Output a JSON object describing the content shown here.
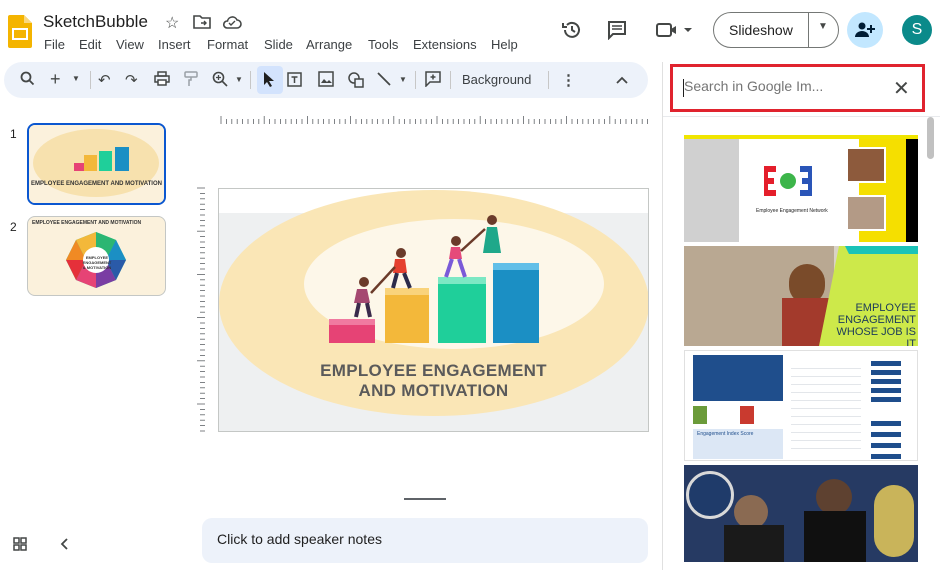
{
  "app": {
    "title": "SketchBubble",
    "menu": [
      "File",
      "Edit",
      "View",
      "Insert",
      "Format",
      "Slide",
      "Arrange",
      "Tools",
      "Extensions",
      "Help"
    ],
    "slideshow_label": "Slideshow",
    "avatar_initial": "S"
  },
  "toolbar": {
    "background_label": "Background",
    "icons": [
      "search-icon",
      "add-icon",
      "undo-icon",
      "redo-icon",
      "print-icon",
      "paint-format-icon",
      "zoom-icon",
      "select-icon",
      "textbox-icon",
      "image-icon",
      "shape-icon",
      "line-icon",
      "comment-icon",
      "more-icon",
      "collapse-icon"
    ]
  },
  "filmstrip": {
    "slides": [
      {
        "number": "1",
        "caption": "EMPLOYEE ENGAGEMENT AND MOTIVATION"
      },
      {
        "number": "2",
        "caption": "EMPLOYEE ENGAGEMENT AND MOTIVATION",
        "center_text": "EMPLOYEE ENGAGEMENT & MOTIVATION"
      }
    ]
  },
  "slide": {
    "title_line1": "EMPLOYEE ENGAGEMENT",
    "title_line2": "AND MOTIVATION"
  },
  "notes": {
    "placeholder": "Click to add speaker notes"
  },
  "image_search": {
    "placeholder": "Search in Google Im...",
    "results": [
      {
        "caption": "Employee Engagement Network"
      },
      {
        "caption": "EMPLOYEE ENGAGEMENT WHOSE JOB IS IT"
      },
      {
        "caption": "Engagement Index Score"
      },
      {
        "caption": ""
      }
    ]
  },
  "colors": {
    "accent_blue": "#0b57d0",
    "toolbar_bg": "#edf2fa",
    "highlight_red": "#e0232e",
    "avatar_teal": "#0b8a8a",
    "share_bg": "#c2e7ff"
  }
}
